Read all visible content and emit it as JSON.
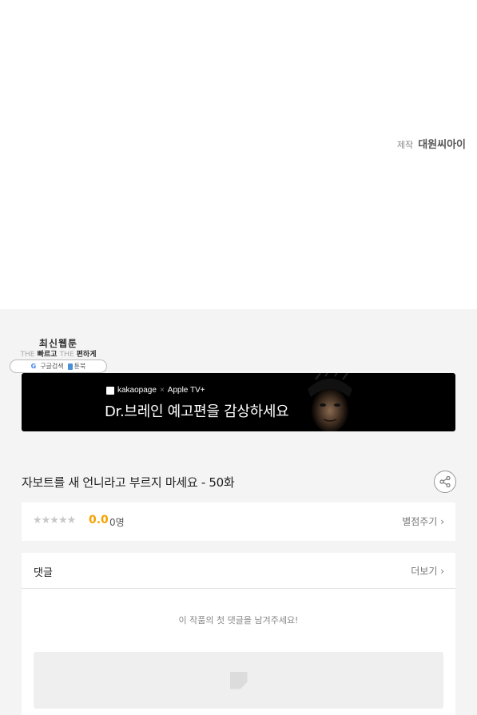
{
  "credit": {
    "label": "제작",
    "company": "대원씨아이"
  },
  "logo": {
    "title": "최신웹툰",
    "sub_the1": "THE",
    "sub_fast": "빠르고",
    "sub_the2": "THE",
    "sub_easy": "편하게",
    "google_glyph": "G",
    "google_label": "구글검색",
    "toonbook_label": "툰북"
  },
  "banner": {
    "brand_kakao": "kakaopage",
    "brand_sep": "×",
    "brand_apple": "Apple TV+",
    "headline": "Dr.브레인 예고편을 감상하세요"
  },
  "episode": {
    "title": "자보트를 새 언니라고 부르지 마세요 - 50화",
    "share_icon": "share-icon"
  },
  "rating": {
    "stars": "★★★★★",
    "score": "0.0",
    "count": "0명",
    "rate_label": "별점주기",
    "chevron": "›"
  },
  "comments": {
    "title": "댓글",
    "more_label": "더보기",
    "chevron": "›",
    "empty_text": "이 작품의 첫 댓글을 남겨주세요!"
  },
  "colors": {
    "accent_score": "#f5a200",
    "banner_bg": "#000000",
    "page_bg": "#f4f4f4"
  }
}
